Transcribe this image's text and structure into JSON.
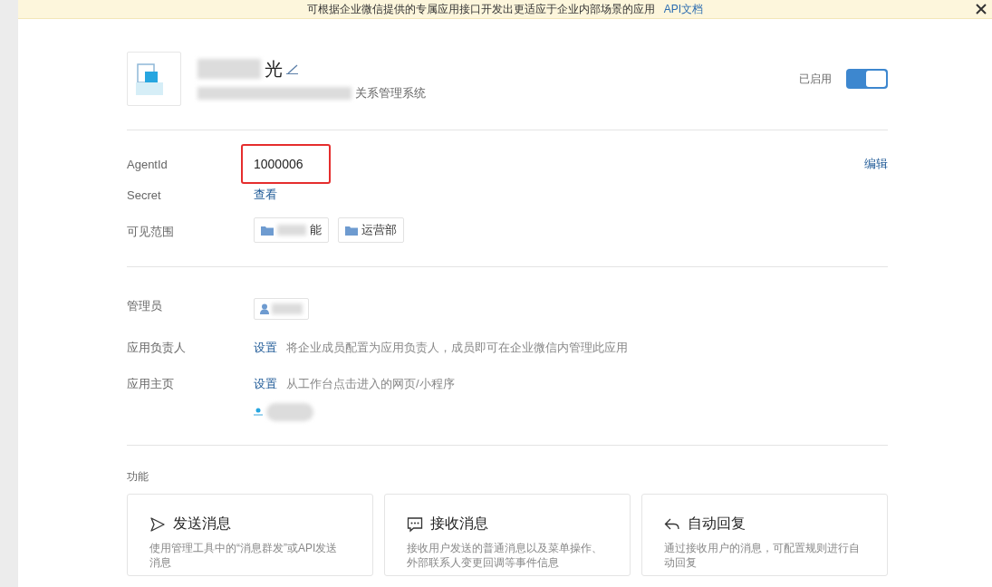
{
  "banner": {
    "text": "可根据企业微信提供的专属应用接口开发出更适应于企业内部场景的应用",
    "link": "API文档"
  },
  "app": {
    "name": "光",
    "description": "关系管理系统",
    "status": "已启用",
    "enabled": true
  },
  "details": {
    "agentid_label": "AgentId",
    "agentid": "1000006",
    "edit": "编辑",
    "secret_label": "Secret",
    "secret_link": "查看",
    "scope_label": "可见范围",
    "scope_tags": [
      {
        "label": "能",
        "blurred": true
      },
      {
        "label": "运营部",
        "blurred": false
      }
    ]
  },
  "roles": [
    {
      "kind": "admin",
      "label": "管理员"
    },
    {
      "kind": "setting",
      "label": "应用负责人",
      "link": "设置",
      "hint": "将企业成员配置为应用负责人，成员即可在企业微信内管理此应用",
      "has_item": false
    },
    {
      "kind": "setting",
      "label": "应用主页",
      "link": "设置",
      "hint": "从工作台点击进入的网页/小程序",
      "has_item": true
    }
  ],
  "features": {
    "title": "功能",
    "cards": [
      {
        "kind": "send",
        "title": "发送消息",
        "lines": [
          "使用管理工具中的“消息群发”或API发送",
          "消息"
        ]
      },
      {
        "kind": "receive",
        "title": "接收消息",
        "lines": [
          "接收用户发送的普通消息以及菜单操作、",
          "外部联系人变更回调等事件信息"
        ]
      },
      {
        "kind": "reply",
        "title": "自动回复",
        "lines": [
          "通过接收用户的消息，可配置规则进行自",
          "动回复"
        ]
      }
    ]
  }
}
